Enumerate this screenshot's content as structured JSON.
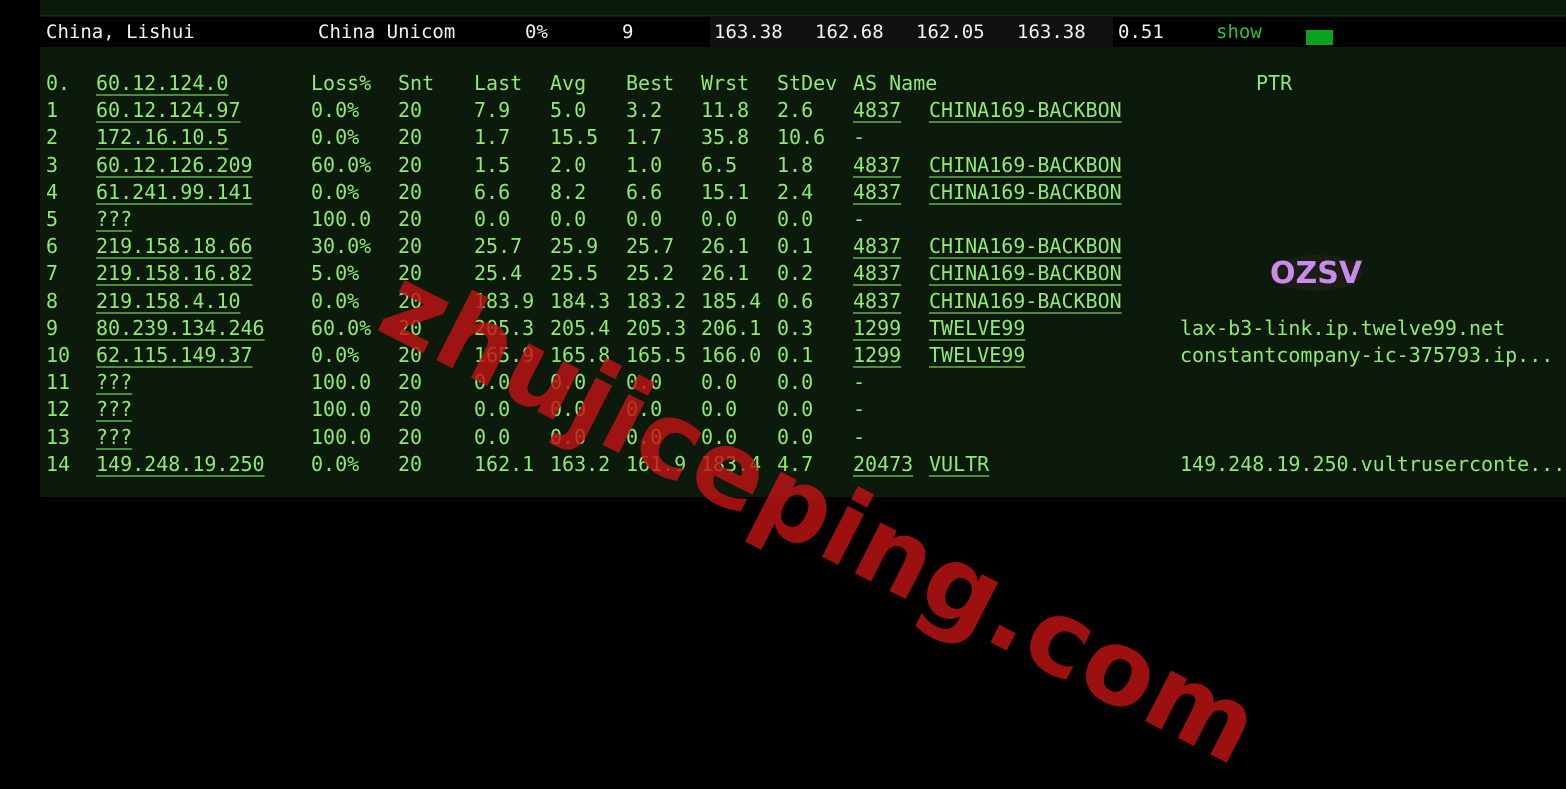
{
  "summary": {
    "location": "China, Lishui",
    "isp": "China Unicom",
    "loss": "0%",
    "hops": "9",
    "v1": "163.38",
    "v2": "162.68",
    "v3": "162.05",
    "v4": "163.38",
    "v5": "0.51",
    "action": "show"
  },
  "columns": [
    "Loss%",
    "Snt",
    "Last",
    "Avg",
    "Best",
    "Wrst",
    "StDev",
    "AS Name",
    "PTR"
  ],
  "header_hop": {
    "num": "0.",
    "host": "60.12.124.0"
  },
  "rows": [
    {
      "num": "1",
      "host": "60.12.124.97",
      "loss": "0.0%",
      "snt": "20",
      "last": "7.9",
      "avg": "5.0",
      "best": "3.2",
      "wrst": "11.8",
      "stdev": "2.6",
      "as": "4837",
      "name": "CHINA169-BACKBON",
      "ptr": ""
    },
    {
      "num": "2",
      "host": "172.16.10.5",
      "loss": "0.0%",
      "snt": "20",
      "last": "1.7",
      "avg": "15.5",
      "best": "1.7",
      "wrst": "35.8",
      "stdev": "10.6",
      "as": "-",
      "name": "",
      "ptr": ""
    },
    {
      "num": "3",
      "host": "60.12.126.209",
      "loss": "60.0%",
      "snt": "20",
      "last": "1.5",
      "avg": "2.0",
      "best": "1.0",
      "wrst": "6.5",
      "stdev": "1.8",
      "as": "4837",
      "name": "CHINA169-BACKBON",
      "ptr": ""
    },
    {
      "num": "4",
      "host": "61.241.99.141",
      "loss": "0.0%",
      "snt": "20",
      "last": "6.6",
      "avg": "8.2",
      "best": "6.6",
      "wrst": "15.1",
      "stdev": "2.4",
      "as": "4837",
      "name": "CHINA169-BACKBON",
      "ptr": ""
    },
    {
      "num": "5",
      "host": "???",
      "loss": "100.0",
      "snt": "20",
      "last": "0.0",
      "avg": "0.0",
      "best": "0.0",
      "wrst": "0.0",
      "stdev": "0.0",
      "as": "-",
      "name": "",
      "ptr": ""
    },
    {
      "num": "6",
      "host": "219.158.18.66",
      "loss": "30.0%",
      "snt": "20",
      "last": "25.7",
      "avg": "25.9",
      "best": "25.7",
      "wrst": "26.1",
      "stdev": "0.1",
      "as": "4837",
      "name": "CHINA169-BACKBON",
      "ptr": ""
    },
    {
      "num": "7",
      "host": "219.158.16.82",
      "loss": "5.0%",
      "snt": "20",
      "last": "25.4",
      "avg": "25.5",
      "best": "25.2",
      "wrst": "26.1",
      "stdev": "0.2",
      "as": "4837",
      "name": "CHINA169-BACKBON",
      "ptr": ""
    },
    {
      "num": "8",
      "host": "219.158.4.10",
      "loss": "0.0%",
      "snt": "20",
      "last": "183.9",
      "avg": "184.3",
      "best": "183.2",
      "wrst": "185.4",
      "stdev": "0.6",
      "as": "4837",
      "name": "CHINA169-BACKBON",
      "ptr": ""
    },
    {
      "num": "9",
      "host": "80.239.134.246",
      "loss": "60.0%",
      "snt": "20",
      "last": "205.3",
      "avg": "205.4",
      "best": "205.3",
      "wrst": "206.1",
      "stdev": "0.3",
      "as": "1299",
      "name": "TWELVE99",
      "ptr": "lax-b3-link.ip.twelve99.net"
    },
    {
      "num": "10",
      "host": "62.115.149.37",
      "loss": "0.0%",
      "snt": "20",
      "last": "165.9",
      "avg": "165.8",
      "best": "165.5",
      "wrst": "166.0",
      "stdev": "0.1",
      "as": "1299",
      "name": "TWELVE99",
      "ptr": "constantcompany-ic-375793.ip..."
    },
    {
      "num": "11",
      "host": "???",
      "loss": "100.0",
      "snt": "20",
      "last": "0.0",
      "avg": "0.0",
      "best": "0.0",
      "wrst": "0.0",
      "stdev": "0.0",
      "as": "-",
      "name": "",
      "ptr": ""
    },
    {
      "num": "12",
      "host": "???",
      "loss": "100.0",
      "snt": "20",
      "last": "0.0",
      "avg": "0.0",
      "best": "0.0",
      "wrst": "0.0",
      "stdev": "0.0",
      "as": "-",
      "name": "",
      "ptr": ""
    },
    {
      "num": "13",
      "host": "???",
      "loss": "100.0",
      "snt": "20",
      "last": "0.0",
      "avg": "0.0",
      "best": "0.0",
      "wrst": "0.0",
      "stdev": "0.0",
      "as": "-",
      "name": "",
      "ptr": ""
    },
    {
      "num": "14",
      "host": "149.248.19.250",
      "loss": "0.0%",
      "snt": "20",
      "last": "162.1",
      "avg": "163.2",
      "best": "161.9",
      "wrst": "183.4",
      "stdev": "4.7",
      "as": "20473",
      "name": "VULTR",
      "ptr": "149.248.19.250.vultruserconte..."
    }
  ],
  "watermark": "zhujiceping.com",
  "logo_text": "OZSV",
  "colors": {
    "text": "#8fea6f",
    "link": "#2fbf3a",
    "status": "#0aa51e",
    "watermark": "#be1414"
  }
}
